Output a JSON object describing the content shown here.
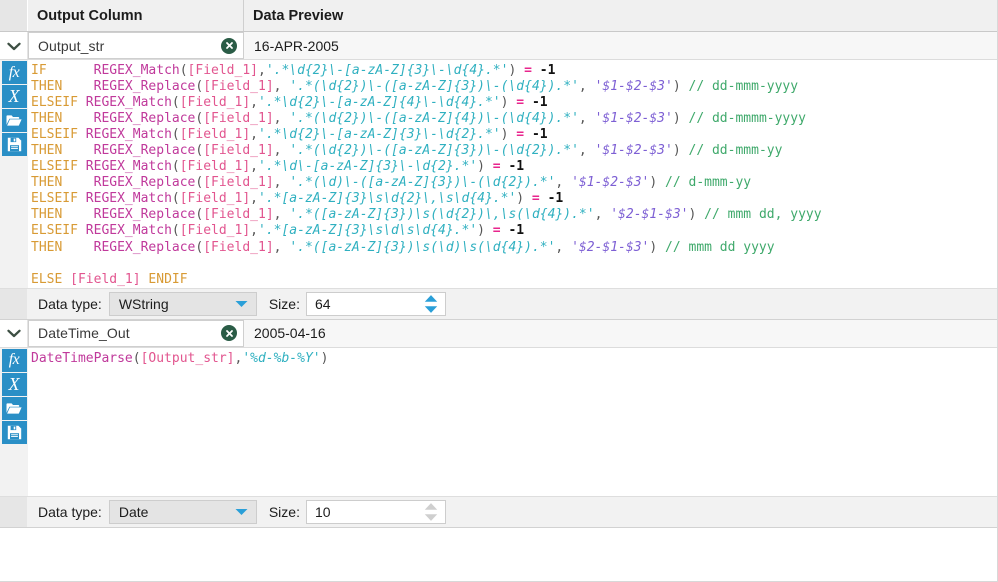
{
  "columns": {
    "output_column_header": "Output Column",
    "data_preview_header": "Data Preview"
  },
  "colors": {
    "tool_button_bg": "#2a8fc6",
    "clear_badge_bg": "#2a5c46",
    "keyword": "#d89a34",
    "function": "#c0399b",
    "field": "#e2558f",
    "string": "#2fb0c0",
    "replacement": "#7d5fd4",
    "operator": "#e8258d",
    "comment": "#3fa96b",
    "header_bg": "#f0f0f0"
  },
  "toolbar": {
    "function_icon": "fx",
    "variable_icon": "X",
    "open_icon": "open-folder-icon",
    "save_icon": "floppy-disk-icon",
    "function_label": "fx",
    "variable_label": "X"
  },
  "blocks": [
    {
      "expand_icon": "chevron-down-icon",
      "name": "Output_str",
      "clear_icon": "clear-circle-icon",
      "preview": "16-APR-2005",
      "data_type_label": "Data type:",
      "data_type_value": "WString",
      "data_type_options": [
        "WString"
      ],
      "size_label": "Size:",
      "size_value": "64",
      "spinner_enabled": true,
      "code_lines": [
        [
          {
            "t": "IF      ",
            "c": "kw"
          },
          {
            "t": "REGEX_Match",
            "c": "fn"
          },
          {
            "t": "(",
            "c": "punct"
          },
          {
            "t": "[Field_1]",
            "c": "fld"
          },
          {
            "t": ",",
            "c": "punct"
          },
          {
            "t": "'.*\\d{2}\\-[a-zA-Z]{3}\\-\\d{4}.*'",
            "c": "str"
          },
          {
            "t": ")",
            "c": "punct"
          },
          {
            "t": " = ",
            "c": "op"
          },
          {
            "t": "-1",
            "c": "num"
          }
        ],
        [
          {
            "t": "THEN    ",
            "c": "kw"
          },
          {
            "t": "REGEX_Replace",
            "c": "fn"
          },
          {
            "t": "(",
            "c": "punct"
          },
          {
            "t": "[Field_1]",
            "c": "fld"
          },
          {
            "t": ", ",
            "c": "punct"
          },
          {
            "t": "'.*(\\d{2})\\-([a-zA-Z]{3})\\-(\\d{4}).*'",
            "c": "str"
          },
          {
            "t": ", ",
            "c": "punct"
          },
          {
            "t": "'$1-$2-$3'",
            "c": "repl"
          },
          {
            "t": ") ",
            "c": "punct"
          },
          {
            "t": "// dd-mmm-yyyy",
            "c": "cmt"
          }
        ],
        [
          {
            "t": "ELSEIF ",
            "c": "kw"
          },
          {
            "t": "REGEX_Match",
            "c": "fn"
          },
          {
            "t": "(",
            "c": "punct"
          },
          {
            "t": "[Field_1]",
            "c": "fld"
          },
          {
            "t": ",",
            "c": "punct"
          },
          {
            "t": "'.*\\d{2}\\-[a-zA-Z]{4}\\-\\d{4}.*'",
            "c": "str"
          },
          {
            "t": ")",
            "c": "punct"
          },
          {
            "t": " = ",
            "c": "op"
          },
          {
            "t": "-1",
            "c": "num"
          }
        ],
        [
          {
            "t": "THEN    ",
            "c": "kw"
          },
          {
            "t": "REGEX_Replace",
            "c": "fn"
          },
          {
            "t": "(",
            "c": "punct"
          },
          {
            "t": "[Field_1]",
            "c": "fld"
          },
          {
            "t": ", ",
            "c": "punct"
          },
          {
            "t": "'.*(\\d{2})\\-([a-zA-Z]{4})\\-(\\d{4}).*'",
            "c": "str"
          },
          {
            "t": ", ",
            "c": "punct"
          },
          {
            "t": "'$1-$2-$3'",
            "c": "repl"
          },
          {
            "t": ") ",
            "c": "punct"
          },
          {
            "t": "// dd-mmmm-yyyy",
            "c": "cmt"
          }
        ],
        [
          {
            "t": "ELSEIF ",
            "c": "kw"
          },
          {
            "t": "REGEX_Match",
            "c": "fn"
          },
          {
            "t": "(",
            "c": "punct"
          },
          {
            "t": "[Field_1]",
            "c": "fld"
          },
          {
            "t": ",",
            "c": "punct"
          },
          {
            "t": "'.*\\d{2}\\-[a-zA-Z]{3}\\-\\d{2}.*'",
            "c": "str"
          },
          {
            "t": ")",
            "c": "punct"
          },
          {
            "t": " = ",
            "c": "op"
          },
          {
            "t": "-1",
            "c": "num"
          }
        ],
        [
          {
            "t": "THEN    ",
            "c": "kw"
          },
          {
            "t": "REGEX_Replace",
            "c": "fn"
          },
          {
            "t": "(",
            "c": "punct"
          },
          {
            "t": "[Field_1]",
            "c": "fld"
          },
          {
            "t": ", ",
            "c": "punct"
          },
          {
            "t": "'.*(\\d{2})\\-([a-zA-Z]{3})\\-(\\d{2}).*'",
            "c": "str"
          },
          {
            "t": ", ",
            "c": "punct"
          },
          {
            "t": "'$1-$2-$3'",
            "c": "repl"
          },
          {
            "t": ") ",
            "c": "punct"
          },
          {
            "t": "// dd-mmm-yy",
            "c": "cmt"
          }
        ],
        [
          {
            "t": "ELSEIF ",
            "c": "kw"
          },
          {
            "t": "REGEX_Match",
            "c": "fn"
          },
          {
            "t": "(",
            "c": "punct"
          },
          {
            "t": "[Field_1]",
            "c": "fld"
          },
          {
            "t": ",",
            "c": "punct"
          },
          {
            "t": "'.*\\d\\-[a-zA-Z]{3}\\-\\d{2}.*'",
            "c": "str"
          },
          {
            "t": ")",
            "c": "punct"
          },
          {
            "t": " = ",
            "c": "op"
          },
          {
            "t": "-1",
            "c": "num"
          }
        ],
        [
          {
            "t": "THEN    ",
            "c": "kw"
          },
          {
            "t": "REGEX_Replace",
            "c": "fn"
          },
          {
            "t": "(",
            "c": "punct"
          },
          {
            "t": "[Field_1]",
            "c": "fld"
          },
          {
            "t": ", ",
            "c": "punct"
          },
          {
            "t": "'.*(\\d)\\-([a-zA-Z]{3})\\-(\\d{2}).*'",
            "c": "str"
          },
          {
            "t": ", ",
            "c": "punct"
          },
          {
            "t": "'$1-$2-$3'",
            "c": "repl"
          },
          {
            "t": ") ",
            "c": "punct"
          },
          {
            "t": "// d-mmm-yy",
            "c": "cmt"
          }
        ],
        [
          {
            "t": "ELSEIF ",
            "c": "kw"
          },
          {
            "t": "REGEX_Match",
            "c": "fn"
          },
          {
            "t": "(",
            "c": "punct"
          },
          {
            "t": "[Field_1]",
            "c": "fld"
          },
          {
            "t": ",",
            "c": "punct"
          },
          {
            "t": "'.*[a-zA-Z]{3}\\s\\d{2}\\,\\s\\d{4}.*'",
            "c": "str"
          },
          {
            "t": ")",
            "c": "punct"
          },
          {
            "t": " = ",
            "c": "op"
          },
          {
            "t": "-1",
            "c": "num"
          }
        ],
        [
          {
            "t": "THEN    ",
            "c": "kw"
          },
          {
            "t": "REGEX_Replace",
            "c": "fn"
          },
          {
            "t": "(",
            "c": "punct"
          },
          {
            "t": "[Field_1]",
            "c": "fld"
          },
          {
            "t": ", ",
            "c": "punct"
          },
          {
            "t": "'.*([a-zA-Z]{3})\\s(\\d{2})\\,\\s(\\d{4}).*'",
            "c": "str"
          },
          {
            "t": ", ",
            "c": "punct"
          },
          {
            "t": "'$2-$1-$3'",
            "c": "repl"
          },
          {
            "t": ") ",
            "c": "punct"
          },
          {
            "t": "// mmm dd, yyyy",
            "c": "cmt"
          }
        ],
        [
          {
            "t": "ELSEIF ",
            "c": "kw"
          },
          {
            "t": "REGEX_Match",
            "c": "fn"
          },
          {
            "t": "(",
            "c": "punct"
          },
          {
            "t": "[Field_1]",
            "c": "fld"
          },
          {
            "t": ",",
            "c": "punct"
          },
          {
            "t": "'.*[a-zA-Z]{3}\\s\\d\\s\\d{4}.*'",
            "c": "str"
          },
          {
            "t": ")",
            "c": "punct"
          },
          {
            "t": " = ",
            "c": "op"
          },
          {
            "t": "-1",
            "c": "num"
          }
        ],
        [
          {
            "t": "THEN    ",
            "c": "kw"
          },
          {
            "t": "REGEX_Replace",
            "c": "fn"
          },
          {
            "t": "(",
            "c": "punct"
          },
          {
            "t": "[Field_1]",
            "c": "fld"
          },
          {
            "t": ", ",
            "c": "punct"
          },
          {
            "t": "'.*([a-zA-Z]{3})\\s(\\d)\\s(\\d{4}).*'",
            "c": "str"
          },
          {
            "t": ", ",
            "c": "punct"
          },
          {
            "t": "'$2-$1-$3'",
            "c": "repl"
          },
          {
            "t": ") ",
            "c": "punct"
          },
          {
            "t": "// mmm dd yyyy",
            "c": "cmt"
          }
        ],
        [],
        [
          {
            "t": "ELSE ",
            "c": "kw"
          },
          {
            "t": "[Field_1]",
            "c": "fld"
          },
          {
            "t": " ENDIF",
            "c": "kw"
          }
        ]
      ]
    },
    {
      "expand_icon": "chevron-down-icon",
      "name": "DateTime_Out",
      "clear_icon": "clear-circle-icon",
      "preview": "2005-04-16",
      "data_type_label": "Data type:",
      "data_type_value": "Date",
      "data_type_options": [
        "Date"
      ],
      "size_label": "Size:",
      "size_value": "10",
      "spinner_enabled": false,
      "code_lines": [
        [
          {
            "t": "DateTimeParse",
            "c": "fn"
          },
          {
            "t": "(",
            "c": "punct"
          },
          {
            "t": "[Output_str]",
            "c": "fld"
          },
          {
            "t": ",",
            "c": "punct"
          },
          {
            "t": "'%d-%b-%Y'",
            "c": "str"
          },
          {
            "t": ")",
            "c": "punct"
          }
        ]
      ]
    }
  ]
}
